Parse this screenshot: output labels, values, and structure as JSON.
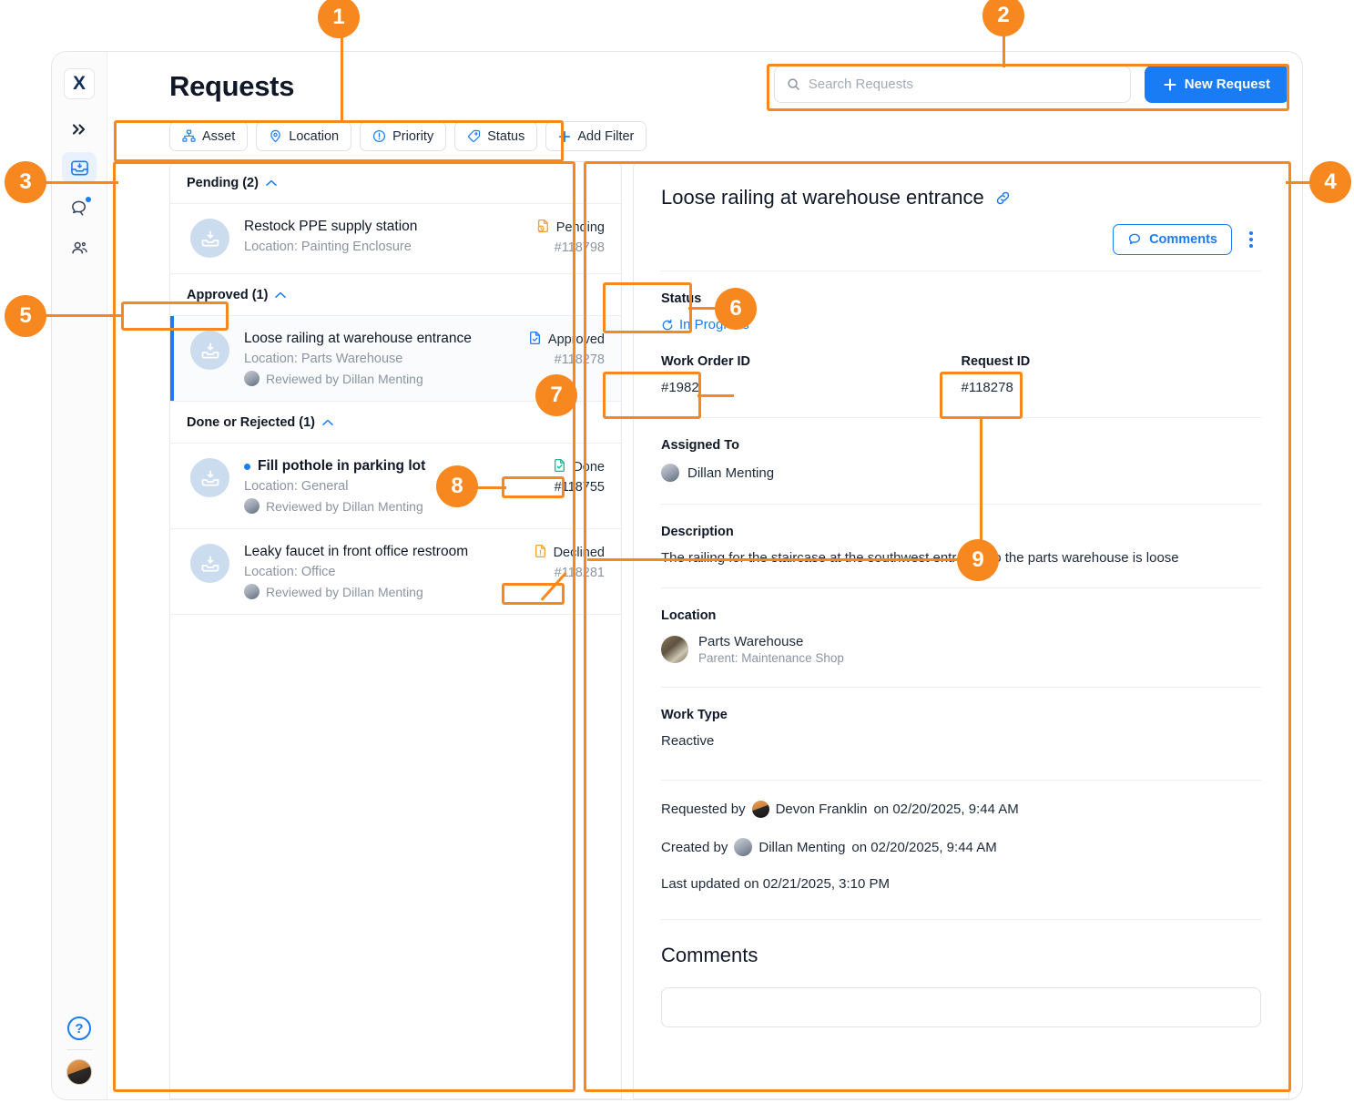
{
  "app": {
    "logo_text": "X",
    "page_title": "Requests"
  },
  "sidebar": {
    "items": [
      {
        "name": "expand",
        "icon": "chevron-double-right-icon",
        "active": false
      },
      {
        "name": "requests",
        "icon": "inbox-icon",
        "active": true
      },
      {
        "name": "messages",
        "icon": "chat-icon",
        "active": false,
        "has_dot": true
      },
      {
        "name": "people",
        "icon": "people-icon",
        "active": false
      }
    ],
    "help_label": "?",
    "avatar_name": "user-avatar"
  },
  "search": {
    "placeholder": "Search Requests",
    "icon": "search-icon"
  },
  "new_request_button": {
    "label": "New Request",
    "icon": "plus-icon"
  },
  "filters": [
    {
      "label": "Asset",
      "icon": "asset-hierarchy-icon"
    },
    {
      "label": "Location",
      "icon": "map-pin-icon"
    },
    {
      "label": "Priority",
      "icon": "alert-circle-icon"
    },
    {
      "label": "Status",
      "icon": "tag-icon"
    },
    {
      "label": "Add Filter",
      "icon": "plus-icon"
    }
  ],
  "list": {
    "groups": [
      {
        "header": "Pending (2)",
        "caret": "⌃",
        "rows": [
          {
            "title": "Restock PPE supply station",
            "location": "Location: Painting Enclosure",
            "reviewed_by": null,
            "status": "Pending",
            "status_color": "#f5a02a",
            "status_icon": "document-clock-icon",
            "id": "#118798",
            "selected": false,
            "unread": false,
            "bold": false
          }
        ]
      },
      {
        "header": "Approved (1)",
        "caret": "⌃",
        "rows": [
          {
            "title": "Loose railing at warehouse entrance",
            "location": "Location: Parts Warehouse",
            "reviewed_by": "Reviewed by Dillan Menting",
            "status": "Approved",
            "status_color": "#1a7cf5",
            "status_icon": "document-check-icon",
            "id": "#118278",
            "selected": true,
            "unread": false,
            "bold": false
          }
        ]
      },
      {
        "header": "Done or Rejected (1)",
        "caret": "⌃",
        "rows": [
          {
            "title": "Fill pothole in parking lot",
            "location": "Location: General",
            "reviewed_by": "Reviewed by Dillan Menting",
            "status": "Done",
            "status_color": "#16b79a",
            "status_icon": "document-done-icon",
            "id": "#118755",
            "selected": false,
            "unread": true,
            "bold": true
          },
          {
            "title": "Leaky faucet in front office restroom",
            "location": "Location: Office",
            "reviewed_by": "Reviewed by Dillan Menting",
            "status": "Declined",
            "status_color": "#f5a02a",
            "status_icon": "document-exclaim-icon",
            "id": "#118281",
            "selected": false,
            "unread": false,
            "bold": false
          }
        ]
      }
    ]
  },
  "detail": {
    "title": "Loose railing at warehouse entrance",
    "link_icon": "link-icon",
    "comments_button": "Comments",
    "comments_icon": "comment-bubble-icon",
    "kebab_icon": "more-vertical-icon",
    "status_label": "Status",
    "status_value": "In Progress",
    "status_icon": "refresh-icon",
    "work_order_label": "Work Order ID",
    "work_order_value": "#1982",
    "request_id_label": "Request ID",
    "request_id_value": "#118278",
    "assigned_label": "Assigned To",
    "assigned_value": "Dillan Menting",
    "description_label": "Description",
    "description_value": "The railing for the staircase at the southwest entrance to the parts warehouse is loose",
    "location_label": "Location",
    "location_name": "Parts Warehouse",
    "location_parent": "Parent: Maintenance Shop",
    "work_type_label": "Work Type",
    "work_type_value": "Reactive",
    "requested_by_prefix": "Requested by",
    "requested_by_name": "Devon Franklin",
    "requested_by_suffix": "on 02/20/2025, 9:44 AM",
    "created_by_prefix": "Created by",
    "created_by_name": "Dillan Menting",
    "created_by_suffix": "on 02/20/2025, 9:44 AM",
    "last_updated": "Last updated on 02/21/2025, 3:10 PM",
    "comments_heading": "Comments"
  },
  "annotations": {
    "accent": "#f7881f",
    "callouts": [
      {
        "number": "1",
        "target": "filter-bar"
      },
      {
        "number": "2",
        "target": "search-and-new-request"
      },
      {
        "number": "3",
        "target": "requests-list-pane"
      },
      {
        "number": "4",
        "target": "request-detail-pane"
      },
      {
        "number": "5",
        "target": "approved-group-header"
      },
      {
        "number": "6",
        "target": "status-field"
      },
      {
        "number": "7",
        "target": "work-order-id-field"
      },
      {
        "number": "8",
        "target": "done-status-badge"
      },
      {
        "number": "9",
        "target": "request-id-field"
      }
    ]
  }
}
